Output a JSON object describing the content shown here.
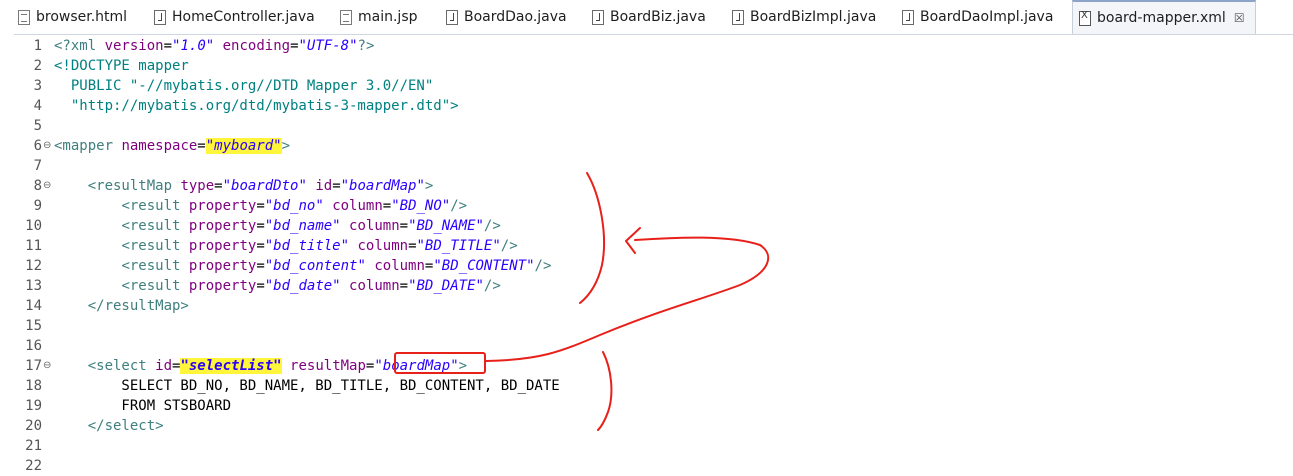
{
  "tabs": [
    {
      "label": "browser.html",
      "icon": "document-icon"
    },
    {
      "label": "HomeController.java",
      "icon": "java-file-icon"
    },
    {
      "label": "main.jsp",
      "icon": "document-icon"
    },
    {
      "label": "BoardDao.java",
      "icon": "java-file-icon"
    },
    {
      "label": "BoardBiz.java",
      "icon": "java-file-icon"
    },
    {
      "label": "BoardBizImpl.java",
      "icon": "java-file-icon"
    },
    {
      "label": "BoardDaoImpl.java",
      "icon": "java-file-icon"
    },
    {
      "label": "board-mapper.xml",
      "icon": "xml-file-icon",
      "active": true,
      "close": "☒"
    }
  ],
  "fold_marker": "⊖",
  "line_numbers": [
    "1",
    "2",
    "3",
    "4",
    "5",
    "6",
    "7",
    "8",
    "9",
    "10",
    "11",
    "12",
    "13",
    "14",
    "15",
    "16",
    "17",
    "18",
    "19",
    "20",
    "21",
    "22"
  ],
  "code": {
    "l1": {
      "a": "<?xml ",
      "b": "version",
      "c": "=",
      "d": "\"1.0\"",
      "e": " ",
      "f": "encoding",
      "g": "=",
      "h": "\"UTF-8\"",
      "i": "?>"
    },
    "l2": "<!DOCTYPE mapper",
    "l3": "  PUBLIC \"-//mybatis.org//DTD Mapper 3.0//EN\"",
    "l4": "  \"http://mybatis.org/dtd/mybatis-3-mapper.dtd\">",
    "l6": {
      "open": "<mapper ",
      "attr": "namespace",
      "eq": "=",
      "val": "\"myboard\"",
      "close": ">"
    },
    "l8": {
      "indent": "    ",
      "open": "<resultMap ",
      "a1": "type",
      "e1": "=",
      "v1": "\"boardDto\"",
      "sp": " ",
      "a2": "id",
      "e2": "=",
      "v2": "\"boardMap\"",
      "close": ">"
    },
    "result_rows": [
      {
        "property": "\"bd_no\"",
        "column": "\"BD_NO\""
      },
      {
        "property": "\"bd_name\"",
        "column": "\"BD_NAME\""
      },
      {
        "property": "\"bd_title\"",
        "column": "\"BD_TITLE\""
      },
      {
        "property": "\"bd_content\"",
        "column": "\"BD_CONTENT\""
      },
      {
        "property": "\"bd_date\"",
        "column": "\"BD_DATE\""
      }
    ],
    "result_open": "<result ",
    "property_attr": "property",
    "column_attr": "column",
    "eq": "=",
    "self_close": "/>",
    "l14": "    </resultMap>",
    "l17": {
      "indent": "    ",
      "open": "<select ",
      "a1": "id",
      "e1": "=",
      "v1": "\"selectList\"",
      "sp": " ",
      "a2": "resultMap",
      "e2": "=",
      "v2": "\"boardMap\"",
      "close": ">"
    },
    "l18": "        SELECT BD_NO, BD_NAME, BD_TITLE, BD_CONTENT, BD_DATE",
    "l19": "        FROM STSBOARD",
    "l20": "    </select>"
  },
  "annotation_color": "#e8201a",
  "highlight_color": "#fff53a"
}
